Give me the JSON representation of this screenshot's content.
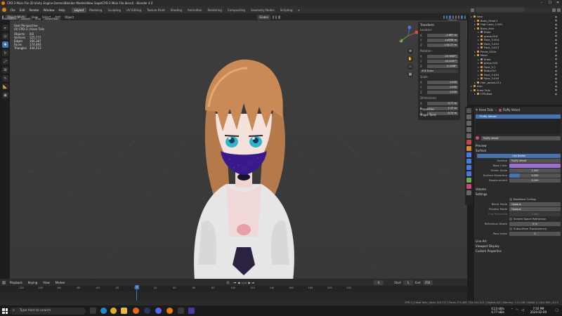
{
  "window": {
    "title": "CPD-3 Main File (D:\\Unity Engine Demos\\Blender Models\\New Saga\\CPD-3 Main File.blend) - Blender 4.0",
    "controls": [
      "–",
      "☐",
      "✕"
    ]
  },
  "menubar": {
    "menus": [
      "File",
      "Edit",
      "Render",
      "Window",
      "Help"
    ],
    "tabs": [
      "Layout",
      "Modeling",
      "Sculpting",
      "UV Editing",
      "Texture Paint",
      "Shading",
      "Animation",
      "Rendering",
      "Compositing",
      "Geometry Nodes",
      "Scripting"
    ],
    "active_tab": "Layout",
    "scene_label": "Scene",
    "view_layer_label": "ViewLayer"
  },
  "viewport_header": {
    "mode": "Object Mode",
    "menus": [
      "View",
      "Select",
      "Add",
      "Object"
    ],
    "orientation_label": "Orientation:",
    "orientation": "Default",
    "drag_label": "Drag",
    "drag": "Select Box",
    "transform": "Global",
    "options": "Options"
  },
  "viewport_overlay": {
    "view_name": "User Perspective",
    "collection": "(0) CPD-3 | Knee Tails",
    "stats": [
      {
        "k": "Objects",
        "v": "0/2"
      },
      {
        "k": "Vertices",
        "v": "125,777"
      },
      {
        "k": "Edges",
        "v": "266,387"
      },
      {
        "k": "Faces",
        "v": "174,493"
      },
      {
        "k": "Triangles",
        "v": "244,513"
      }
    ]
  },
  "npanel": {
    "transform_title": "Transform",
    "location_label": "Location",
    "location": [
      "X",
      "Y",
      "Z"
    ],
    "location_values": [
      "-1.687 m",
      "1.6298 m",
      "1.82.27 m"
    ],
    "rotation_label": "Rotation",
    "rotation_values": [
      "-10.9487°",
      "-10.4287°",
      "4.2208°"
    ],
    "rotation_mode": "XYZ Euler",
    "scale_label": "Scale",
    "scale_values": [
      "1.000",
      "1.000",
      "1.000"
    ],
    "dimensions_label": "Dimensions",
    "dimensions_values": [
      "0.77 m",
      "1.17 m",
      "0.73 m"
    ],
    "properties": "Properties",
    "magic_tools": "Magic Tools"
  },
  "timeline": {
    "menus": [
      "Playback",
      "Keying",
      "View",
      "Marker"
    ],
    "ticks": [
      "-120",
      "-100",
      "-80",
      "-60",
      "-40",
      "-20",
      "0",
      "20",
      "40",
      "60",
      "80",
      "100",
      "120",
      "140",
      "160",
      "180",
      "200",
      "220"
    ],
    "current_frame": "0",
    "start_label": "Start",
    "start": "1",
    "end_label": "End",
    "end": "250"
  },
  "statusbar": {
    "text": "CPD-3 | Head Tails | Verts 125,777 | Faces 174,493 | Tris 244,513 | Objects 0/2 | Memory: 3.21 GiB | VRAM: 2.1/6.0 GiB | 4.0.2"
  },
  "outliner": {
    "rows": [
      {
        "name": "Vest",
        "indent": 0,
        "color": "#e0a64a"
      },
      {
        "name": "Body_Head.1",
        "indent": 1,
        "color": "#e0a64a"
      },
      {
        "name": "High Lash_1.001",
        "indent": 1,
        "color": "#e0a64a"
      },
      {
        "name": "Bone_Hair",
        "indent": 1,
        "color": "#e0a64a"
      },
      {
        "name": "Knee",
        "indent": 2,
        "color": "#b88fdc"
      },
      {
        "name": "group.019",
        "indent": 2,
        "color": "#e0a64a"
      },
      {
        "name": "Face_3.004",
        "indent": 2,
        "color": "#e0a64a"
      },
      {
        "name": "Face_3.012",
        "indent": 2,
        "color": "#e0a64a"
      },
      {
        "name": "Face_3.013",
        "indent": 2,
        "color": "#e0a64a"
      },
      {
        "name": "Plane_002b",
        "indent": 1,
        "color": "#e0a64a"
      },
      {
        "name": "Mesh",
        "indent": 1,
        "color": "#e0a64a"
      },
      {
        "name": "Knee",
        "indent": 2,
        "color": "#b88fdc"
      },
      {
        "name": "group.020",
        "indent": 2,
        "color": "#e0a64a"
      },
      {
        "name": "Face_3.1",
        "indent": 2,
        "color": "#e0a64a"
      },
      {
        "name": "Body.001",
        "indent": 2,
        "color": "#e0a64a"
      },
      {
        "name": "Face_3.015",
        "indent": 2,
        "color": "#e0a64a"
      },
      {
        "name": "Face_3.016",
        "indent": 2,
        "color": "#e0a64a"
      },
      {
        "name": "Hair_Jacket.011",
        "indent": 1,
        "color": "#e0a64a"
      },
      {
        "name": "Arm",
        "indent": 0,
        "color": "#e0a64a"
      },
      {
        "name": "Knee Tails",
        "indent": 0,
        "color": "#e0a64a"
      },
      {
        "name": "CPD-Bod",
        "indent": 1,
        "color": "#e0a64a"
      }
    ]
  },
  "properties": {
    "breadcrumb_object": "Knee Tails",
    "breadcrumb_material": "Fluffy Velvet",
    "slot_name": "Fluffy Velvet",
    "material_name": "Fluffy Velvet",
    "sections": {
      "preview": "Preview",
      "surface": "Surface",
      "volume": "Volume",
      "settings": "Settings",
      "line_art": "Line Art",
      "viewport_display": "Viewport Display",
      "custom_properties": "Custom Properties"
    },
    "use_nodes": "Use Nodes",
    "surface_label": "Surface",
    "surface_value": "Fluffy Velvet",
    "base_color_label": "Base Color",
    "base_color": "#9d6fd0",
    "fields": [
      {
        "label": "Sheen Scale",
        "value": "1.500"
      },
      {
        "label": "Surface Distortion",
        "value": "0.200"
      },
      {
        "label": "Displacement",
        "value": "0.100"
      }
    ],
    "settings_fields": [
      {
        "label": "",
        "value": "Backface Culling",
        "checkbox": true
      },
      {
        "label": "Blend Mode",
        "value": "Opaque"
      },
      {
        "label": "Shadow Mode",
        "value": "Opaque"
      },
      {
        "label": "Clip Threshold",
        "value": "0.500"
      },
      {
        "label": "",
        "value": "Screen Space Refraction",
        "checkbox": true
      },
      {
        "label": "Refraction Depth",
        "value": "0 m"
      },
      {
        "label": "",
        "value": "Subsurface Translucency",
        "checkbox": true
      },
      {
        "label": "Pass Index",
        "value": "0"
      }
    ]
  },
  "taskbar": {
    "search_placeholder": "Type here to search",
    "net_up": "0.23 kB/s",
    "net_down": "0.77 kB/s",
    "time": "7:10 PM",
    "date": "2024-02-09"
  },
  "colors": {
    "accent": "#4772b3",
    "mask": "#3a1a8a",
    "hair": "#c98a55",
    "eye": "#2fb3c6"
  }
}
